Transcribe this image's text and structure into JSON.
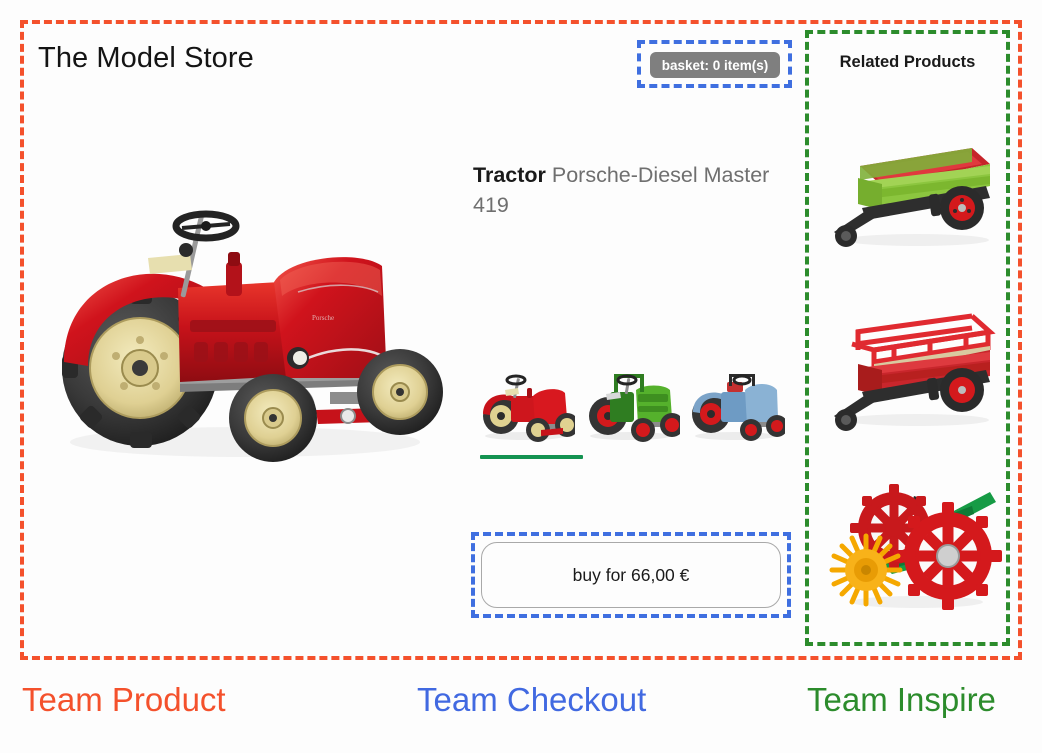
{
  "store": {
    "title": "The Model Store"
  },
  "basket": {
    "label": "basket: 0 item(s)"
  },
  "product": {
    "brand_word": "Tractor",
    "name": "Porsche-Diesel Master 419",
    "hero_alt": "red-tractor-hero-image",
    "buy_label": "buy for 66,00 €",
    "price": "66,00 €",
    "variants": [
      {
        "name": "red-tractor-variant",
        "color": "#D01A17",
        "selected": true
      },
      {
        "name": "green-tractor-variant",
        "color": "#3C9A1E",
        "selected": false
      },
      {
        "name": "blue-tractor-variant",
        "color": "#6E9BC4",
        "selected": false
      }
    ]
  },
  "related": {
    "title": "Related Products",
    "items": [
      {
        "name": "green-red-farm-trailer",
        "body": "#8CC63F",
        "bed": "#CE2027"
      },
      {
        "name": "red-stake-bed-trailer",
        "body": "#D62027",
        "bed": "#D9C9A0"
      },
      {
        "name": "red-green-hay-tedder-implement",
        "body": "#169B45",
        "wheel": "#D4191C"
      }
    ]
  },
  "teams": [
    {
      "label": "Team Product",
      "color": "#F4512C"
    },
    {
      "label": "Team Checkout",
      "color": "#4169E1"
    },
    {
      "label": "Team Inspire",
      "color": "#2C8C2C"
    }
  ],
  "boundaries": {
    "product_color": "#F4512C",
    "checkout_color": "#3F6FE0",
    "inspire_color": "#2C8C2C"
  }
}
